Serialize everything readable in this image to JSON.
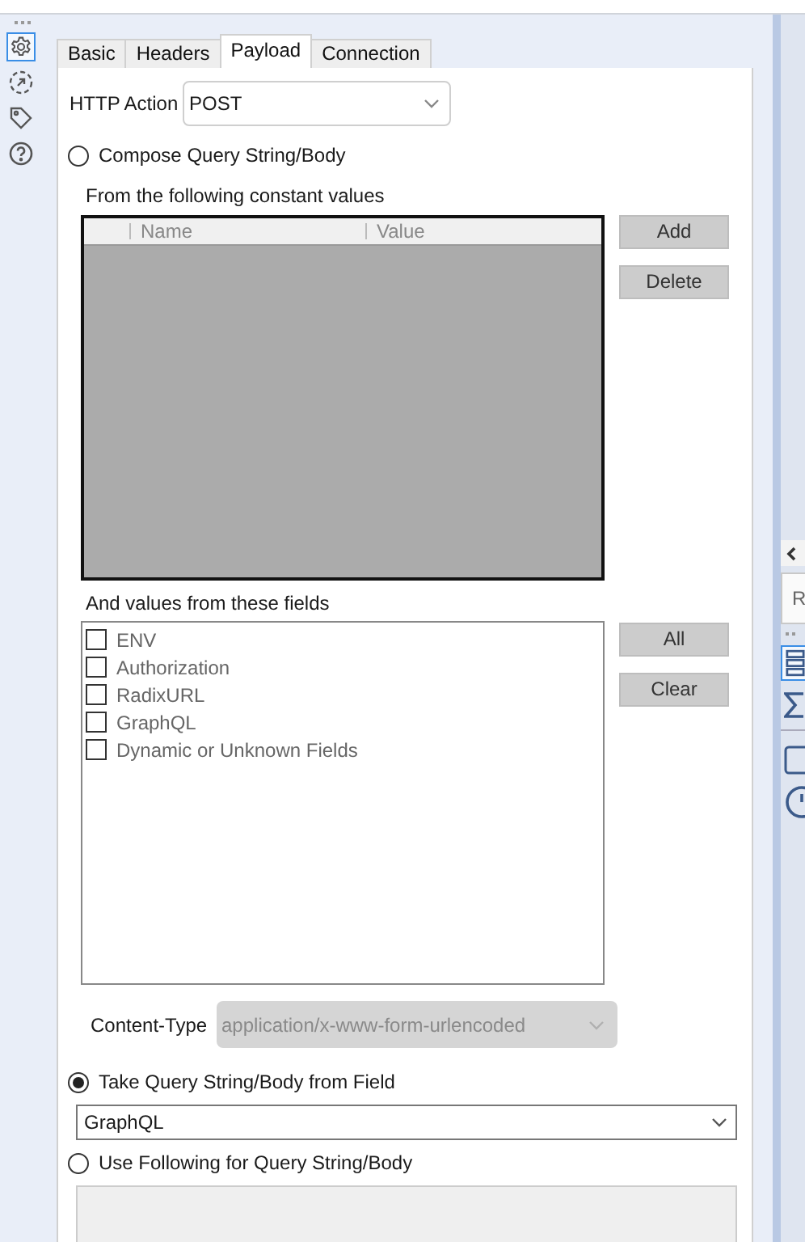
{
  "sidebar_icons": [
    {
      "kind": "settings",
      "selected": true
    },
    {
      "kind": "link",
      "selected": false
    },
    {
      "kind": "tag",
      "selected": false
    },
    {
      "kind": "help",
      "selected": false
    }
  ],
  "tabs": [
    {
      "label": "Basic",
      "selected": false
    },
    {
      "label": "Headers",
      "selected": false
    },
    {
      "label": "Payload",
      "selected": true
    },
    {
      "label": "Connection",
      "selected": false
    }
  ],
  "http_action": {
    "label": "HTTP Action",
    "value": "POST"
  },
  "compose": {
    "label": "Compose Query String/Body",
    "selected": false
  },
  "constants": {
    "caption": "From the following constant values",
    "columns": [
      "Name",
      "Value"
    ],
    "buttons": [
      "Add",
      "Delete"
    ]
  },
  "fields": {
    "caption": "And values from these fields",
    "buttons": [
      "All",
      "Clear"
    ],
    "items": [
      {
        "label": "ENV",
        "checked": false
      },
      {
        "label": "Authorization",
        "checked": false
      },
      {
        "label": "RadixURL",
        "checked": false
      },
      {
        "label": "GraphQL",
        "checked": false
      },
      {
        "label": "Dynamic or Unknown Fields",
        "checked": false
      }
    ]
  },
  "content_type": {
    "label": "Content-Type",
    "value": "application/x-www-form-urlencoded",
    "disabled": true
  },
  "take_from_field": {
    "label": "Take Query String/Body from Field",
    "selected": true,
    "value": "GraphQL"
  },
  "use_following": {
    "label": "Use Following for Query String/Body",
    "selected": false
  },
  "right_panel": {
    "tab_label": "R",
    "icons": [
      {
        "kind": "list",
        "selected": true
      },
      {
        "kind": "sum",
        "selected": false
      },
      {
        "kind": "square",
        "selected": false
      },
      {
        "kind": "clock",
        "selected": false
      }
    ]
  }
}
